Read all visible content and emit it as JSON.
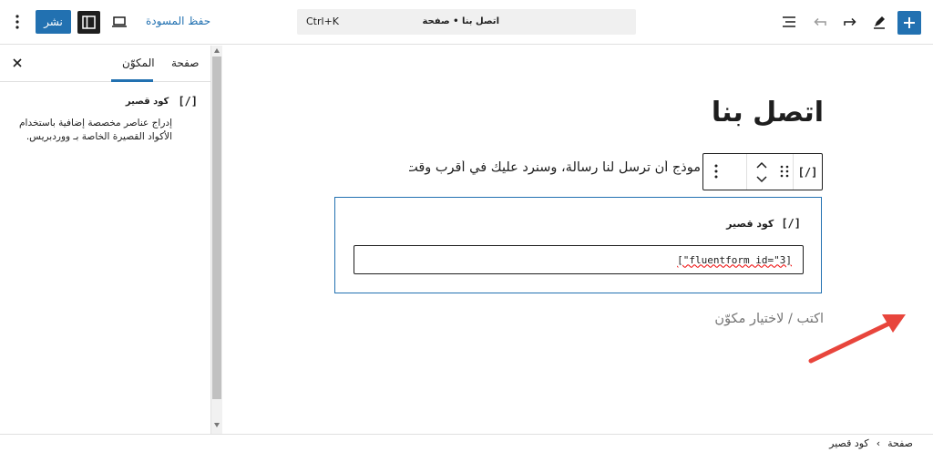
{
  "header": {
    "publish_label": "نشر",
    "save_draft_label": "حفظ المسودة",
    "command_shortcut": "Ctrl+K",
    "command_title": "اتصل بنا • صفحة"
  },
  "sidebar": {
    "tabs": [
      "المكوّن",
      "صفحة"
    ],
    "active_tab": "المكوّن",
    "block_icon": "[/]",
    "block_name": "كود قصير",
    "block_description": "إدراج عناصر مخصصة إضافية باستخدام الأكواد القصيرة الخاصة بـ ووردبريس."
  },
  "editor": {
    "page_title": "اتصل بنا",
    "paragraph": "موذج أن ترسل لنا رسالة، وسنرد عليك في أقرب وقت.",
    "toolbar_block_icon": "[/]",
    "shortcode_label": "كود قصير",
    "shortcode_icon": "[/]",
    "shortcode_value": "[\"fluentform id=\"3]",
    "placeholder": "اكتب / لاختيار مكوّن"
  },
  "breadcrumb": [
    "صفحة",
    "كود قصير"
  ],
  "colors": {
    "accent": "#2271b1",
    "arrow": "#e8453c"
  }
}
